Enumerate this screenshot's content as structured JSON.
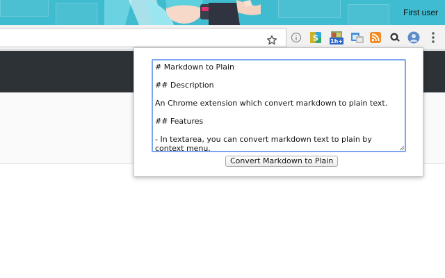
{
  "window": {
    "profile_name": "First user"
  },
  "toolbar": {
    "bookmark_icon": "star-icon",
    "extensions": [
      {
        "name": "info-icon"
      },
      {
        "name": "s-extension-icon",
        "glyph": "S"
      },
      {
        "name": "1h-extension-icon",
        "badge": "1h+"
      },
      {
        "name": "window-extension-icon"
      },
      {
        "name": "rss-icon"
      },
      {
        "name": "search-extension-icon"
      },
      {
        "name": "avatar-extension-icon"
      }
    ],
    "menu_icon": "kebab-menu-icon"
  },
  "popup": {
    "textarea_value": "# Markdown to Plain\n\n## Description\n\nAn Chrome extension which convert markdown to plain text.\n\n## Features\n\n- In textarea, you can convert markdown text to plain by context menu.",
    "button_label": "Convert Markdown to Plain"
  },
  "colors": {
    "theme": "#3fbcd0",
    "page_header": "#2d3237",
    "focus_ring": "#7aa6ef",
    "rss": "#f28b22",
    "s_extension": "#2fa7d8"
  }
}
